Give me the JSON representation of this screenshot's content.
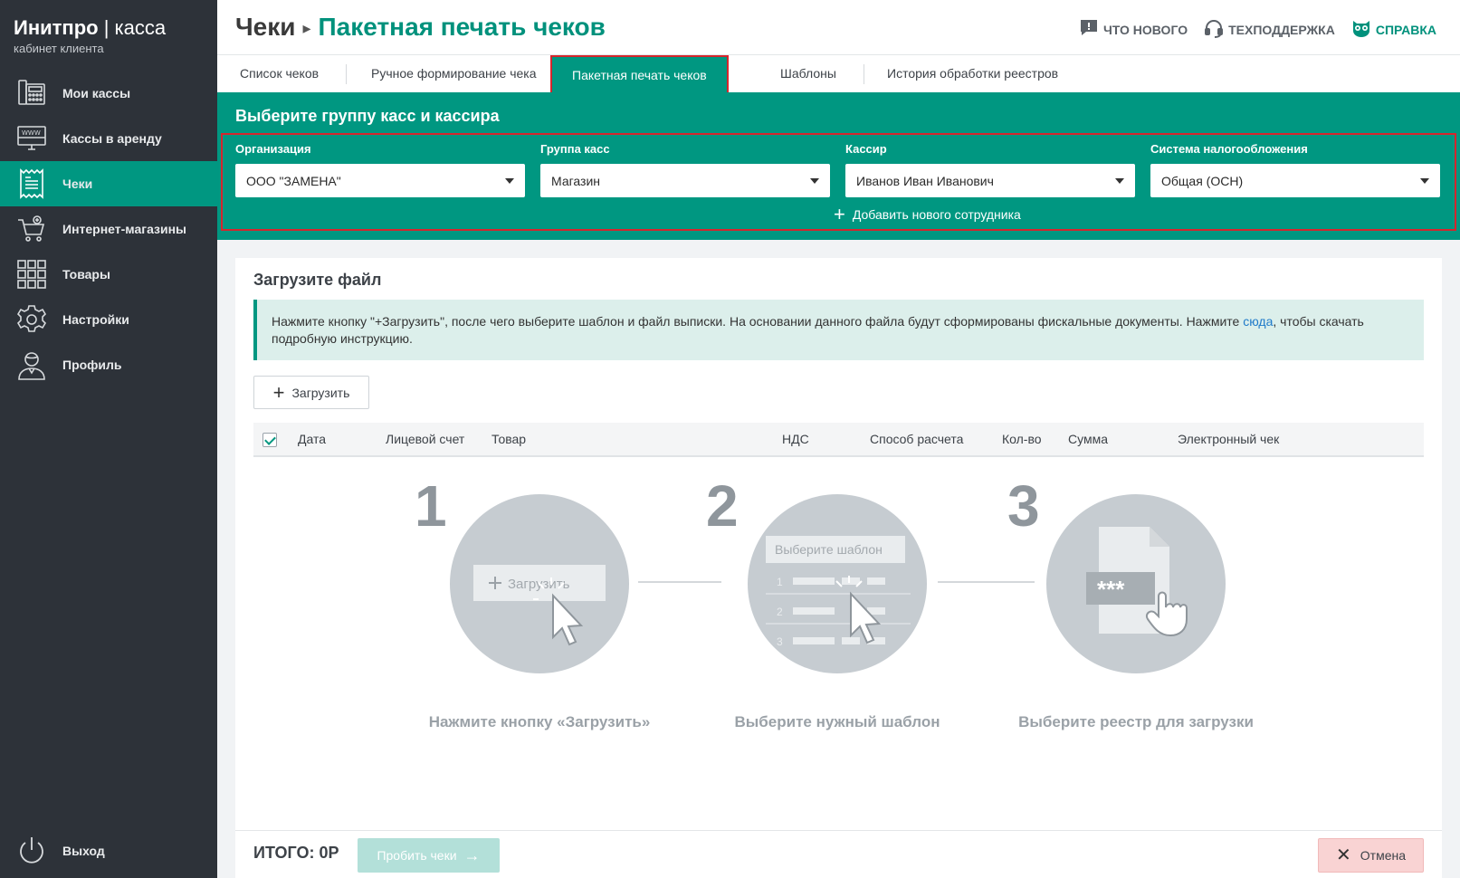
{
  "brand": {
    "name": "Инитпро",
    "product": "касса",
    "subtitle": "кабинет клиента"
  },
  "sidebar": {
    "items": [
      {
        "label": "Мои кассы",
        "icon": "cash-register-icon",
        "active": false
      },
      {
        "label": "Кассы в аренду",
        "icon": "monitor-www-icon",
        "active": false
      },
      {
        "label": "Чеки",
        "icon": "receipt-icon",
        "active": true
      },
      {
        "label": "Интернет-магазины",
        "icon": "shopping-cart-icon",
        "active": false
      },
      {
        "label": "Товары",
        "icon": "grid-icon",
        "active": false
      },
      {
        "label": "Настройки",
        "icon": "gear-icon",
        "active": false
      },
      {
        "label": "Профиль",
        "icon": "user-icon",
        "active": false
      }
    ],
    "logout": "Выход"
  },
  "header": {
    "crumb": "Чеки",
    "current": "Пакетная печать чеков",
    "links": {
      "whats_new": "ЧТО НОВОГО",
      "support": "ТЕХПОДДЕРЖКА",
      "help": "СПРАВКА"
    }
  },
  "tabs": [
    "Список чеков",
    "Ручное формирование чека",
    "Пакетная печать чеков",
    "Шаблоны",
    "История обработки реестров"
  ],
  "panel": {
    "title": "Выберите группу касс и кассира",
    "fields": [
      {
        "label": "Организация",
        "value": "ООО \"ЗАМЕНА\""
      },
      {
        "label": "Группа касс",
        "value": "Магазин"
      },
      {
        "label": "Кассир",
        "value": "Иванов Иван Иванович"
      },
      {
        "label": "Система налогообложения",
        "value": "Общая (ОСН)"
      }
    ],
    "add_employee": "Добавить нового сотрудника"
  },
  "upload": {
    "title": "Загрузите файл",
    "info_before": "Нажмите кнопку \"+Загрузить\", после чего выберите шаблон и файл выписки. На основании данного файла будут сформированы фискальные документы. Нажмите ",
    "info_link": "сюда",
    "info_after": ", чтобы скачать подробную инструкцию.",
    "button": "Загрузить"
  },
  "table": {
    "columns": [
      "Дата",
      "Лицевой счет",
      "Товар",
      "НДС",
      "Способ расчета",
      "Кол-во",
      "Сумма",
      "Электронный чек"
    ]
  },
  "steps": [
    {
      "num": "1",
      "caption": "Нажмите кнопку «Загрузить»",
      "illus_text": "Загрузить"
    },
    {
      "num": "2",
      "caption": "Выберите нужный шаблон",
      "illus_text": "Выберите шаблон",
      "rows": [
        "1",
        "2",
        "3"
      ]
    },
    {
      "num": "3",
      "caption": "Выберите реестр для загрузки",
      "illus_text": "***"
    }
  ],
  "footer": {
    "total": "ИТОГО: 0Р",
    "print": "Пробить чеки",
    "cancel": "Отмена"
  },
  "colors": {
    "accent": "#009781",
    "sidebar": "#2d3239",
    "highlight": "#d5262d"
  }
}
